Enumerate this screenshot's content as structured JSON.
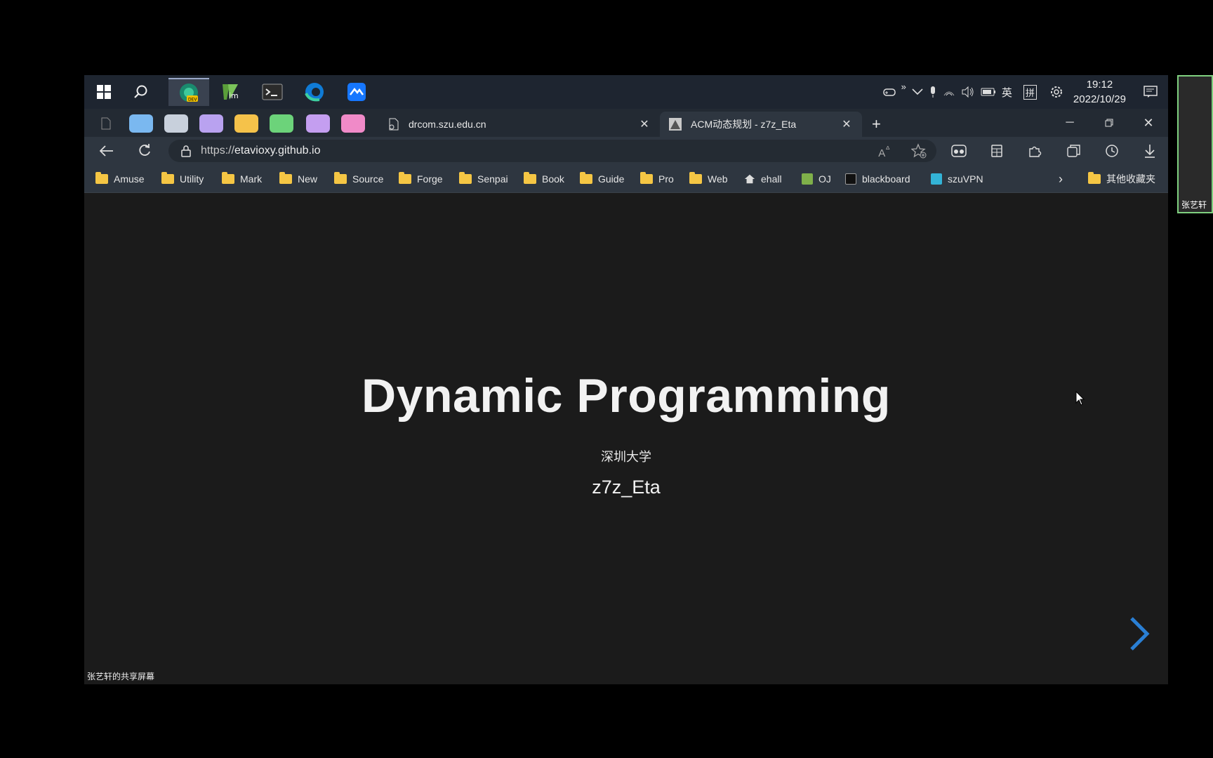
{
  "taskbar": {
    "apps": [
      "start-icon",
      "search-icon",
      "edge-dev-icon",
      "vim-icon",
      "terminal-icon",
      "edge-icon",
      "feishu-icon"
    ],
    "clock_time": "19:12",
    "clock_date": "2022/10/29",
    "ime_lang": "英",
    "ime_mode": "拼"
  },
  "tabs": [
    {
      "title": "drcom.szu.edu.cn",
      "active": false
    },
    {
      "title": "ACM动态规划 - z7z_Eta",
      "active": true
    }
  ],
  "address": {
    "scheme": "https://",
    "host": "etavioxy.github.io"
  },
  "favorites": [
    {
      "label": "Amuse",
      "type": "folder"
    },
    {
      "label": "Utility",
      "type": "folder"
    },
    {
      "label": "Mark",
      "type": "folder"
    },
    {
      "label": "New",
      "type": "folder"
    },
    {
      "label": "Source",
      "type": "folder"
    },
    {
      "label": "Forge",
      "type": "folder"
    },
    {
      "label": "Senpai",
      "type": "folder"
    },
    {
      "label": "Book",
      "type": "folder"
    },
    {
      "label": "Guide",
      "type": "folder"
    },
    {
      "label": "Pro",
      "type": "folder"
    },
    {
      "label": "Web",
      "type": "folder"
    },
    {
      "label": "ehall",
      "type": "home"
    },
    {
      "label": "OJ",
      "type": "page"
    },
    {
      "label": "blackboard",
      "type": "page"
    },
    {
      "label": "szuVPN",
      "type": "page"
    }
  ],
  "other_favorites": "其他收藏夹",
  "slide": {
    "title": "Dynamic Programming",
    "subtitle": "深圳大学",
    "author": "z7z_Eta"
  },
  "share_label": "张艺轩的共享屏幕",
  "side_participant": "张艺轩",
  "colors": {
    "slide_bg": "#1b1b1b",
    "nav_arrow": "#2a7fd4",
    "folder": "#f5c644"
  }
}
